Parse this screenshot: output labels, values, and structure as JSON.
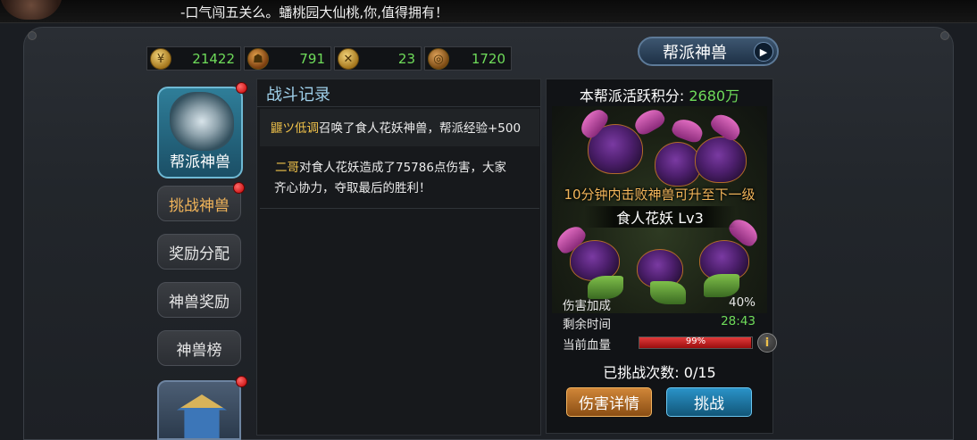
{
  "ticker": {
    "message": "-口气闯五关么。蟠桃园大仙桃,你,值得拥有！"
  },
  "currencies": [
    {
      "icon": "gold-coin-icon",
      "value": "21422"
    },
    {
      "icon": "beast-head-icon",
      "value": "791"
    },
    {
      "icon": "swords-emblem-icon",
      "value": "23"
    },
    {
      "icon": "contribution-medal-icon",
      "value": "1720"
    }
  ],
  "header": {
    "beast_button": "帮派神兽"
  },
  "nav": {
    "card_label": "帮派神兽",
    "items": [
      {
        "label": "挑战神兽",
        "active": true,
        "badge": true
      },
      {
        "label": "奖励分配",
        "active": false,
        "badge": false
      },
      {
        "label": "神兽奖励",
        "active": false,
        "badge": false
      },
      {
        "label": "神兽榜",
        "active": false,
        "badge": false
      }
    ]
  },
  "log": {
    "title": "战斗记录",
    "entries": [
      {
        "name": "鼴ツ低调",
        "text": "召唤了食人花妖神兽，帮派经验+500"
      },
      {
        "name": "二哥",
        "text": "对食人花妖造成了75786点伤害，大家",
        "text2": "齐心协力，夺取最后的胜利！"
      }
    ]
  },
  "beast": {
    "activity_label": "本帮派活跃积分:",
    "activity_value": "2680万",
    "levelup_hint": "10分钟内击败神兽可升至下一级",
    "name": "食人花妖",
    "level": "Lv3",
    "stats": {
      "damage_bonus_label": "伤害加成",
      "damage_bonus_value": "40%",
      "time_left_label": "剩余时间",
      "time_left_value": "28:43",
      "hp_label": "当前血量",
      "hp_text": "99%",
      "hp_fraction": 0.99
    },
    "challenges_label": "已挑战次数: 0/15",
    "detail_button": "伤害详情",
    "challenge_button": "挑战"
  },
  "colors": {
    "accent_green": "#6fdc5a",
    "accent_gold": "#f2b55a",
    "name_gold": "#f0c24a"
  }
}
